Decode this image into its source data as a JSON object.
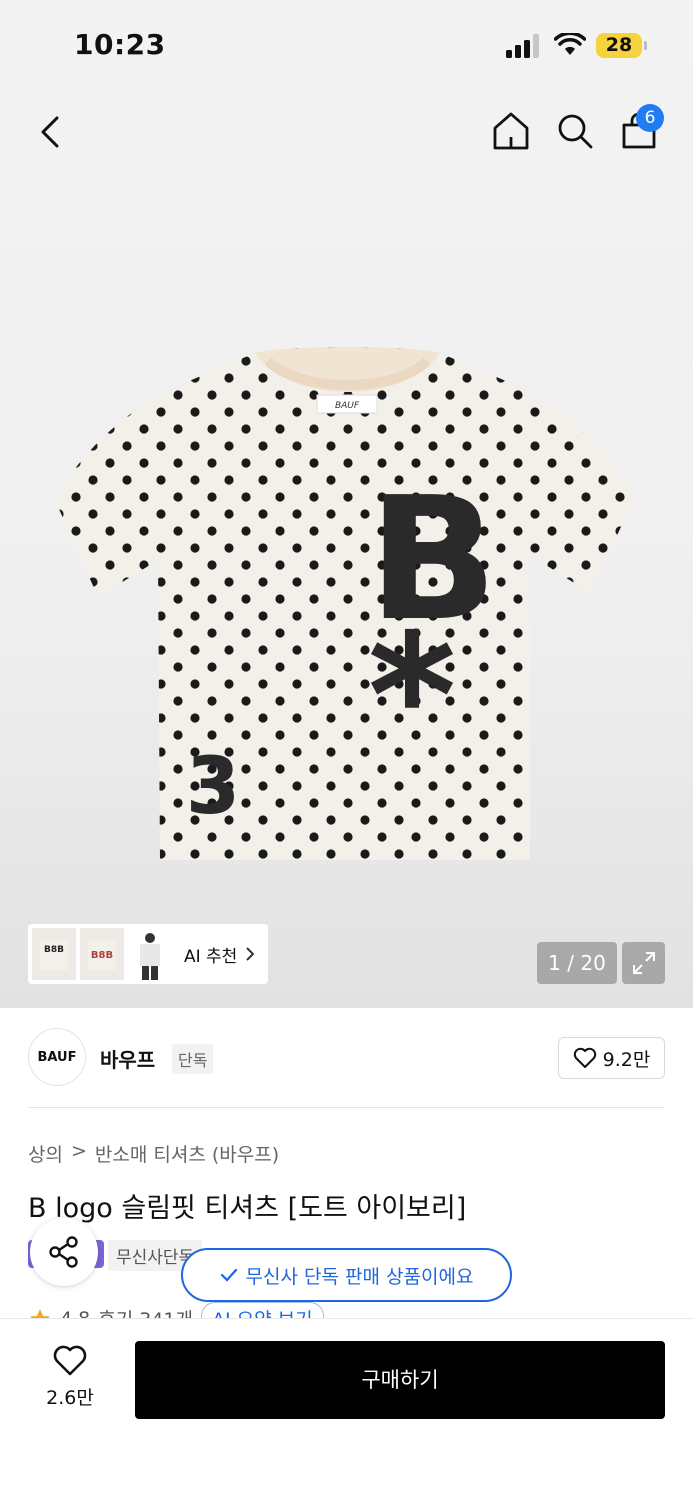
{
  "status_bar": {
    "time": "10:23",
    "battery": "28"
  },
  "nav": {
    "cart_count": "6"
  },
  "gallery": {
    "ai_recommend_label": "AI 추천",
    "counter": "1 / 20",
    "print_letter": "B",
    "print_asterisk": "*",
    "print_number": "3",
    "thumb_print": "B8B"
  },
  "brand": {
    "logo_text": "BAUF",
    "name": "바우프",
    "tag": "단독",
    "likes": "9.2만"
  },
  "breadcrumb": [
    "상의",
    ">",
    "반소매 티셔츠 (바우프)"
  ],
  "product": {
    "title": "B logo 슬림핏 티셔츠 [도트 아이보리]",
    "exclusive_chip": "무신사단독",
    "exclusive_tooltip": "무신사 단독 판매 상품이에요",
    "rating": "4.8",
    "reviews": "후기 341개",
    "ai_summary": "AI 요약 보기"
  },
  "bottom": {
    "fav_count": "2.6만",
    "buy_label": "구매하기"
  },
  "colors": {
    "accent": "#1f66e0",
    "badge": "#1f7cf2",
    "buy": "#000000"
  },
  "icons": [
    "back-arrow-icon",
    "home-icon",
    "search-icon",
    "shopping-bag-icon",
    "expand-icon",
    "heart-icon",
    "share-icon",
    "star-icon",
    "chevron-right-icon",
    "check-icon",
    "wifi-icon",
    "signal-icon"
  ]
}
